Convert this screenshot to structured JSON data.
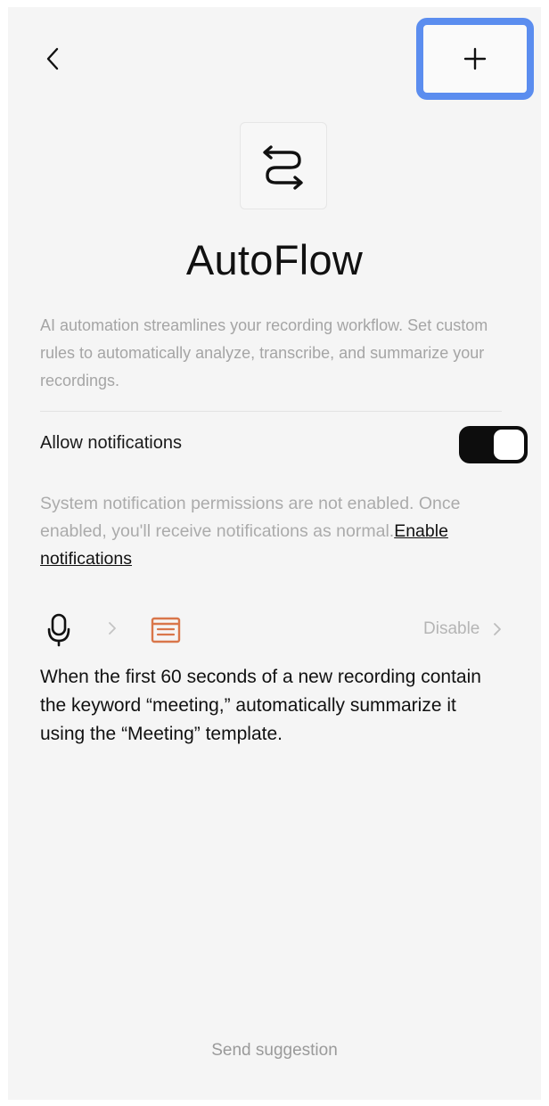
{
  "header": {
    "back_icon": "chevron-left-icon",
    "add_icon": "plus-icon",
    "highlight_color": "#5b8def"
  },
  "app": {
    "icon": "swap-arrows-icon",
    "title": "AutoFlow",
    "description": "AI automation streamlines your recording workflow. Set custom rules to automatically analyze, transcribe, and summarize your recordings."
  },
  "notifications": {
    "label": "Allow notifications",
    "toggle_on": true,
    "system_note": "System notification permissions are not enabled. Once enabled, you'll receive notifications as normal.",
    "enable_link": "Enable notifications"
  },
  "rule": {
    "trigger_icon": "microphone-icon",
    "action_icon": "document-summary-icon",
    "action_icon_color": "#d9764a",
    "disable_label": "Disable",
    "text": "When the first 60 seconds of a new recording contain the keyword “meeting,” automatically summarize it using the “Meeting” template."
  },
  "footer": {
    "suggest_label": "Send suggestion"
  }
}
